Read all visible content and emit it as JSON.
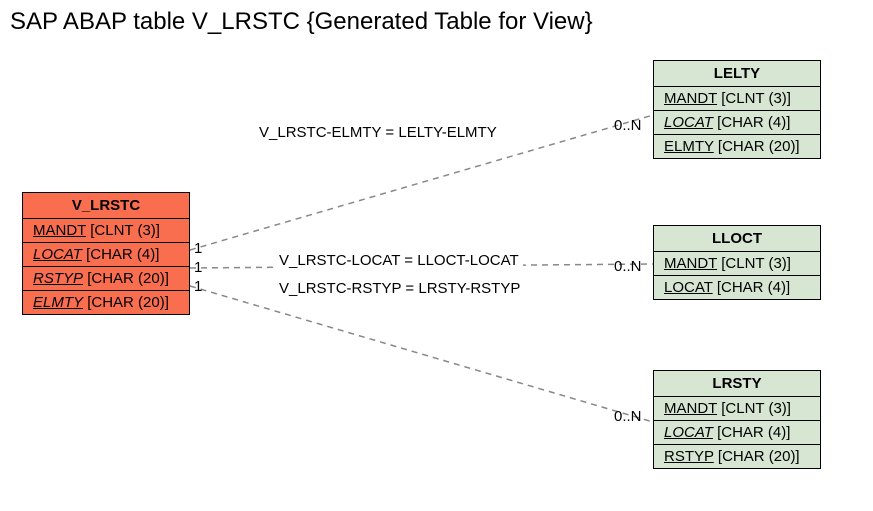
{
  "title": "SAP ABAP table V_LRSTC {Generated Table for View}",
  "main": {
    "name": "V_LRSTC",
    "fields": {
      "f0": {
        "key": "MANDT",
        "type": "[CLNT (3)]"
      },
      "f1": {
        "key": "LOCAT",
        "type": "[CHAR (4)]"
      },
      "f2": {
        "key": "RSTYP",
        "type": "[CHAR (20)]"
      },
      "f3": {
        "key": "ELMTY",
        "type": "[CHAR (20)]"
      }
    }
  },
  "lelty": {
    "name": "LELTY",
    "fields": {
      "f0": {
        "key": "MANDT",
        "type": "[CLNT (3)]"
      },
      "f1": {
        "key": "LOCAT",
        "type": "[CHAR (4)]"
      },
      "f2": {
        "key": "ELMTY",
        "type": "[CHAR (20)]"
      }
    }
  },
  "lloct": {
    "name": "LLOCT",
    "fields": {
      "f0": {
        "key": "MANDT",
        "type": "[CLNT (3)]"
      },
      "f1": {
        "key": "LOCAT",
        "type": "[CHAR (4)]"
      }
    }
  },
  "lrsty": {
    "name": "LRSTY",
    "fields": {
      "f0": {
        "key": "MANDT",
        "type": "[CLNT (3)]"
      },
      "f1": {
        "key": "LOCAT",
        "type": "[CHAR (4)]"
      },
      "f2": {
        "key": "RSTYP",
        "type": "[CHAR (20)]"
      }
    }
  },
  "relations": {
    "r1": "V_LRSTC-ELMTY = LELTY-ELMTY",
    "r2": "V_LRSTC-LOCAT = LLOCT-LOCAT",
    "r3": "V_LRSTC-RSTYP = LRSTY-RSTYP"
  },
  "cardinality": {
    "one": "1",
    "many": "0..N"
  }
}
